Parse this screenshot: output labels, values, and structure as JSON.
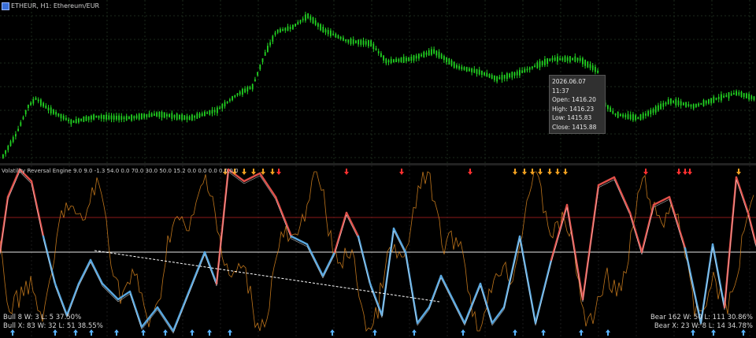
{
  "chart": {
    "symbol_label": "ETHEUR, H1:  Ethereum/EUR",
    "tooltip": {
      "datetime": "2026.06.07 11:37",
      "open": "Open: 1416.20",
      "high": "High: 1416.23",
      "low": "Low: 1415.83",
      "close": "Close: 1415.88"
    }
  },
  "indicator": {
    "title": "Volatility Reversal Engine 9.0 9.0 -1.3 54.0 0.0 70.0 30.0 50.0 15.2 0.0 0.0 0.0 0.0 0.0",
    "stats_left": {
      "bull": "Bull 8   W: 3   L: 5   37.50%",
      "bull_x": "Bull X: 83   W: 32   L: 51   38.55%"
    },
    "stats_right": {
      "bear": "Bear 162   W: 50   L: 111   30.86%",
      "bear_x": "Bear X: 23   W: 8   L: 14   34.78%"
    },
    "levels": {
      "upper": 70,
      "middle": 50
    },
    "colors": {
      "candle": "#22d322",
      "bull_line": "#5aa8e0",
      "bear_line": "#e0504a",
      "fast_line": "#e08a20",
      "upper_level": "#8b1a1a",
      "middle_level": "#e8e8e8",
      "up_arrow": "#5ab4ff",
      "down_arrow": "#ff3030",
      "warn_arrow": "#f0a020"
    }
  }
}
